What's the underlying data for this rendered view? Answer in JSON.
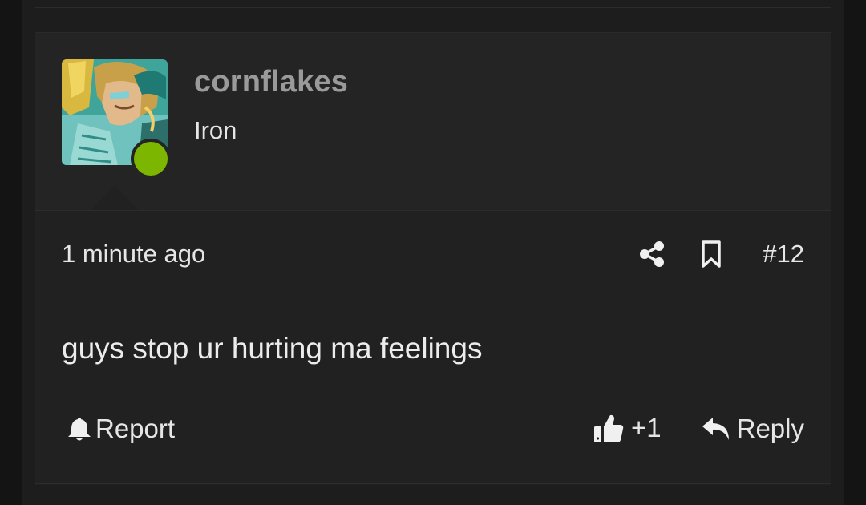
{
  "post": {
    "username": "cornflakes",
    "user_title": "Iron",
    "online": true,
    "timestamp": "1 minute ago",
    "post_number": "#12",
    "message": "guys stop ur hurting ma feelings",
    "actions": {
      "report_label": "Report",
      "like_count": "+1",
      "reply_label": "Reply"
    }
  },
  "icons": {
    "share": "share-icon",
    "bookmark": "bookmark-icon",
    "report": "bell-icon",
    "like": "thumbs-up-icon",
    "reply": "reply-arrow-icon"
  },
  "colors": {
    "background": "#212121",
    "header_background": "#242424",
    "username": "#9a9a9a",
    "text": "#e6e6e6",
    "online_indicator": "#7db600"
  }
}
